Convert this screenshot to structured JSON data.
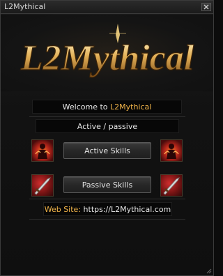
{
  "window": {
    "title": "L2Mythical"
  },
  "logo": {
    "text": "L2Mythical"
  },
  "welcome": {
    "prefix": "Welcome to ",
    "name": "L2Mythical"
  },
  "section": {
    "title": "Active / passive"
  },
  "buttons": {
    "active_label": "Active Skills",
    "passive_label": "Passive Skills"
  },
  "footer": {
    "label": "Web Site:",
    "url": "https://L2Mythical.com"
  },
  "icons": {
    "active": "active-skill-icon",
    "passive": "passive-skill-icon",
    "close": "close-icon"
  },
  "colors": {
    "accent": "#f2b54a",
    "logo_gold": "#d9a64a",
    "background": "#121212"
  }
}
